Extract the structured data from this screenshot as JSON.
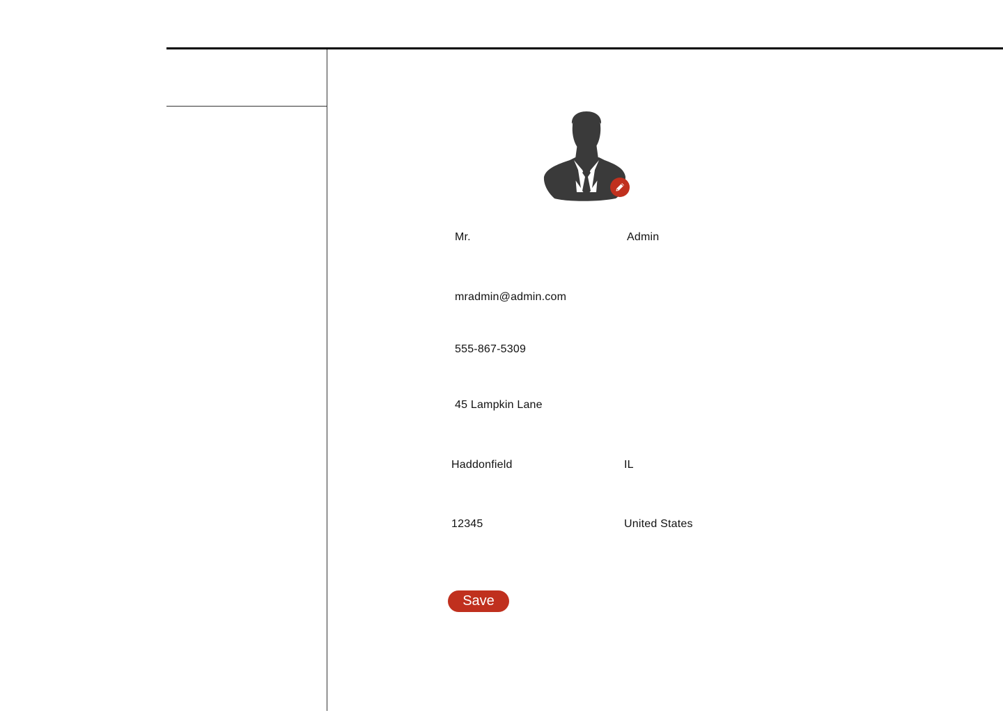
{
  "profile": {
    "title": "Mr.",
    "name": "Admin",
    "email": "mradmin@admin.com",
    "phone": "555-867-5309",
    "address": "45 Lampkin Lane",
    "city": "Haddonfield",
    "state": "IL",
    "zip": "12345",
    "country": "United States"
  },
  "avatar": {
    "icon": "person-silhouette-icon",
    "edit_icon": "pencil-icon"
  },
  "actions": {
    "save_label": "Save"
  },
  "colors": {
    "accent": "#c0301e",
    "avatar_fill": "#3a3a3a",
    "rule": "#000000"
  }
}
